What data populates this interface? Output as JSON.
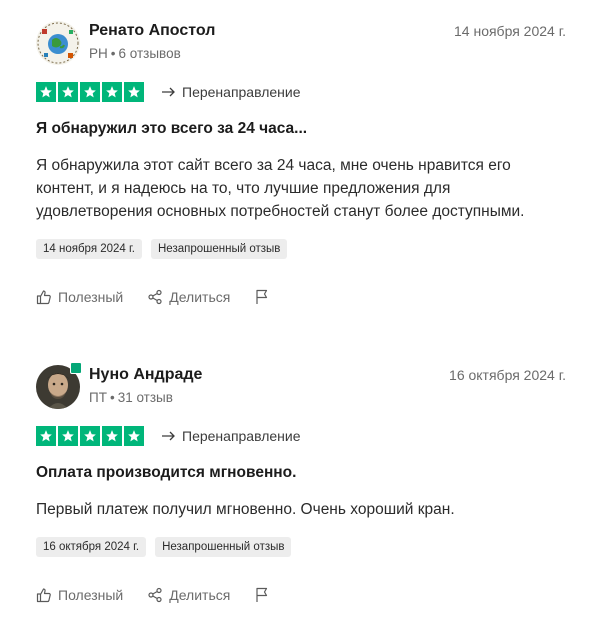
{
  "reviews": [
    {
      "author": "Ренато Апостол",
      "country": "PH",
      "review_count": "6 отзывов",
      "date": "14 ноября 2024 г.",
      "redirect_label": "Перенаправление",
      "title": "Я обнаружил это всего за 24 часа...",
      "body": "Я обнаружила этот сайт всего за 24 часа, мне очень нравится его контент, и я надеюсь на то, что лучшие предложения для удовлетворения основных потребностей станут более доступными.",
      "date_tag": "14 ноября 2024 г.",
      "type_tag": "Незапрошенный отзыв",
      "helpful_label": "Полезный",
      "share_label": "Делиться",
      "rating": 5,
      "avatar_icon": "logo-globe-avatar"
    },
    {
      "author": "Нуно Андраде",
      "country": "ПТ",
      "review_count": "31 отзыв",
      "date": "16 октября 2024 г.",
      "redirect_label": "Перенаправление",
      "title": "Оплата производится мгновенно.",
      "body": "Первый платеж получил мгновенно. Очень хороший кран.",
      "date_tag": "16 октября 2024 г.",
      "type_tag": "Незапрошенный отзыв",
      "helpful_label": "Полезный",
      "share_label": "Делиться",
      "rating": 5,
      "avatar_icon": "user-photo-avatar",
      "verified": true
    }
  ],
  "colors": {
    "star_green": "#00b67a",
    "verified_green": "#04a777",
    "tag_bg": "#ededed",
    "muted_text": "#6b6b6b"
  }
}
